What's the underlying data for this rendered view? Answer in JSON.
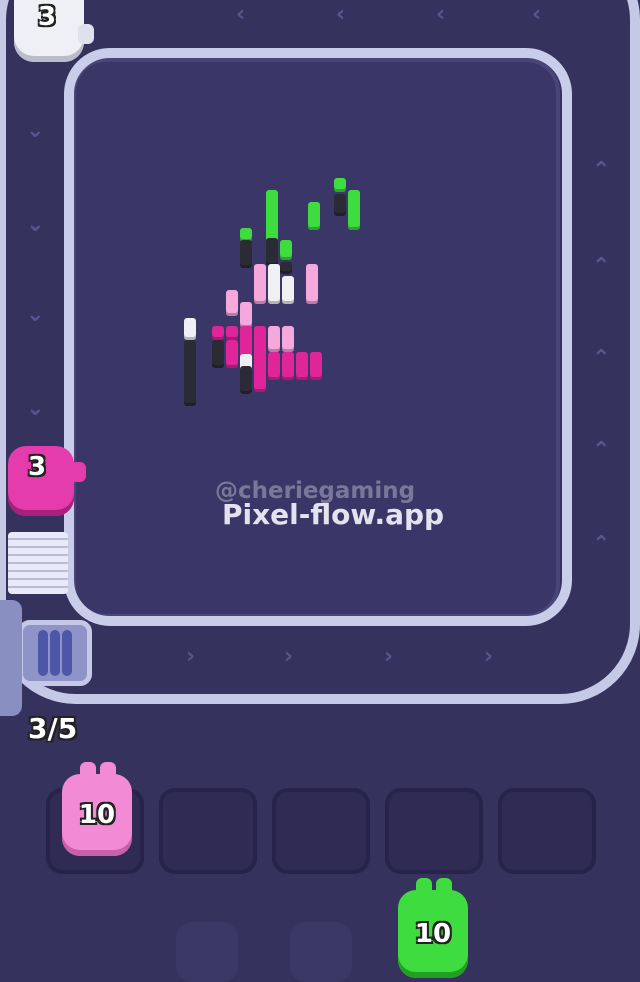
{
  "watermark": {
    "handle": "@cheriegaming",
    "site": "Pixel-flow.app"
  },
  "conveyor": {
    "capacity_label": "3/5"
  },
  "shooters_on_belt": [
    {
      "color": "white",
      "count": "3"
    },
    {
      "color": "pink",
      "count": "3"
    }
  ],
  "queue": [
    {
      "color": "pink",
      "count": "10"
    },
    {
      "color": "green",
      "count": "10"
    }
  ],
  "colors": {
    "background": "#36325e",
    "board": "#3a3668",
    "rail": "#cfd3ee",
    "pink": "#f060c8",
    "magenta": "#e0259a",
    "light_pink": "#f4a8dc",
    "green": "#3fdc3f",
    "white": "#f0f0f4",
    "dark": "#2b2b35"
  },
  "pixel_art": {
    "description_colors": [
      "green",
      "pink",
      "magenta",
      "white",
      "dark"
    ]
  }
}
